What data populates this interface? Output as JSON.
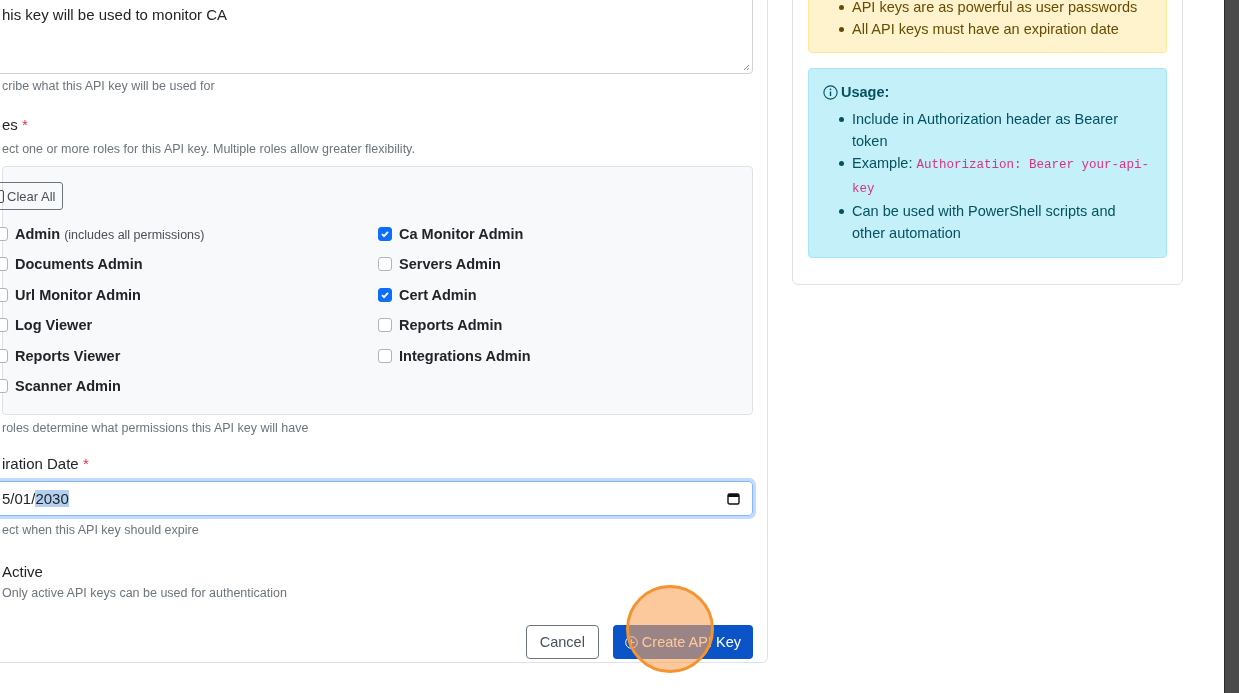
{
  "description": {
    "value": "his key will be used to monitor CA",
    "help": "cribe what this API key will be used for"
  },
  "roles": {
    "label": "es",
    "required_mark": "*",
    "help": "ect one or more roles for this API key. Multiple roles allow greater flexibility.",
    "clear_button": "Clear All",
    "items": [
      {
        "name": "Admin",
        "note": "(includes all permissions)",
        "checked": false
      },
      {
        "name": "Ca Monitor Admin",
        "checked": true
      },
      {
        "name": "Documents Admin",
        "checked": false
      },
      {
        "name": "Servers Admin",
        "checked": false
      },
      {
        "name": "Url Monitor Admin",
        "checked": false
      },
      {
        "name": "Cert Admin",
        "checked": true
      },
      {
        "name": "Log Viewer",
        "checked": false
      },
      {
        "name": "Reports Admin",
        "checked": false
      },
      {
        "name": "Reports Viewer",
        "checked": false
      },
      {
        "name": "Integrations Admin",
        "checked": false
      },
      {
        "name": "Scanner Admin",
        "checked": false
      }
    ],
    "footer_help": "roles determine what permissions this API key will have"
  },
  "expiration": {
    "label": "iration Date",
    "required_mark": "*",
    "value": "5/01/",
    "selected_value": "2030",
    "help": "ect when this API key should expire"
  },
  "active": {
    "label": "Active",
    "help": "Only active API keys can be used for authentication"
  },
  "buttons": {
    "cancel": "Cancel",
    "create": "Create API Key",
    "click_highlight": true
  },
  "warning": {
    "items": [
      "API keys are as powerful as user passwords",
      "All API keys must have an expiration date"
    ]
  },
  "usage": {
    "title": "Usage:",
    "items": [
      {
        "text": "Include in Authorization header as Bearer token"
      },
      {
        "text": "Example:",
        "code": "Authorization: Bearer your-api-key"
      },
      {
        "text": "Can be used with PowerShell scripts and other automation"
      }
    ]
  }
}
